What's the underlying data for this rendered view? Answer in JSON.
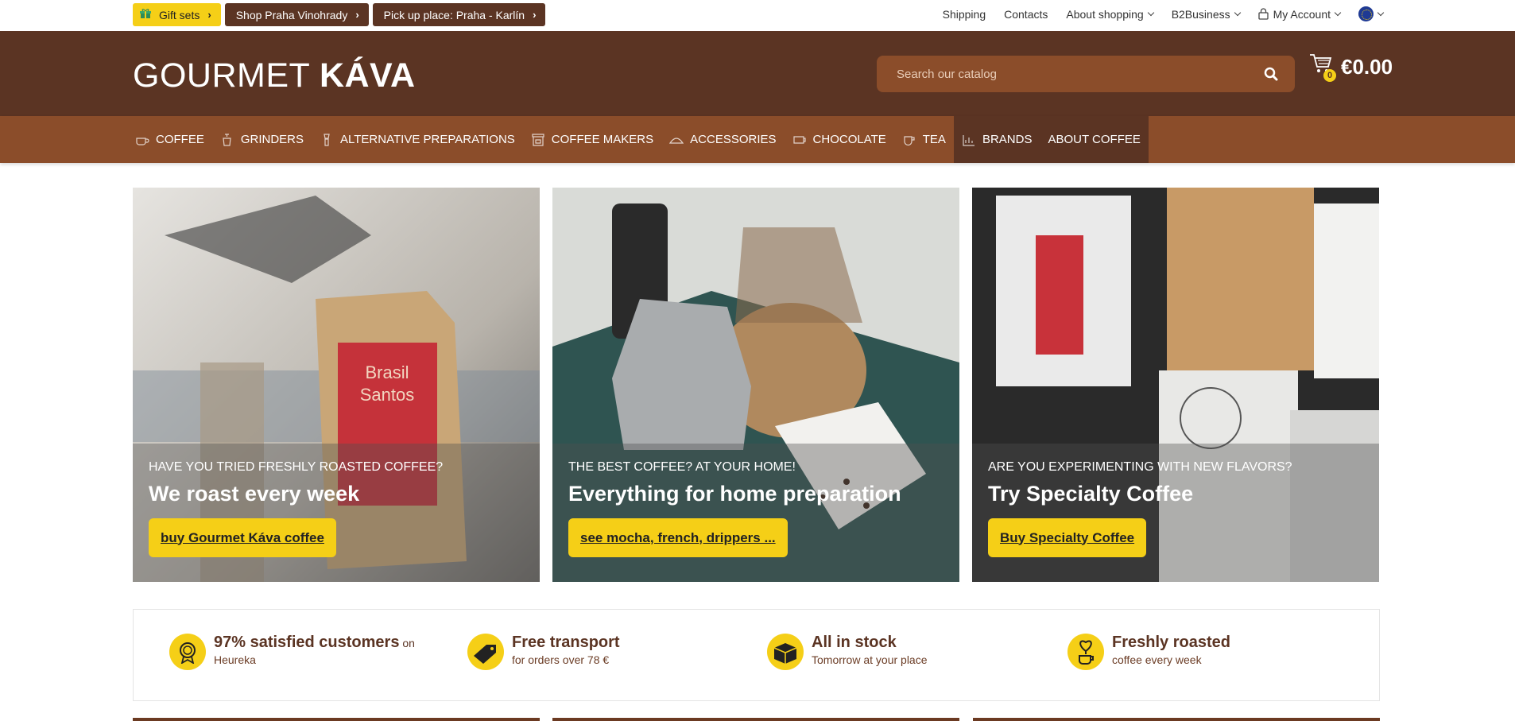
{
  "topbar": {
    "gift": "Gift sets",
    "shop": "Shop Praha Vinohrady",
    "pickup": "Pick up place: Praha - Karlín",
    "links": [
      "Shipping",
      "Contacts",
      "About shopping",
      "B2Business",
      "My Account"
    ]
  },
  "header": {
    "logo_light": "GOURMET ",
    "logo_bold": "KÁVA",
    "search_placeholder": "Search our catalog",
    "cart_count": "0",
    "cart_total": "€0.00"
  },
  "nav": [
    {
      "label": "COFFEE",
      "icon": "coffee-cup-icon"
    },
    {
      "label": "GRINDERS",
      "icon": "grinder-icon"
    },
    {
      "label": "ALTERNATIVE PREPARATIONS",
      "icon": "dripper-icon"
    },
    {
      "label": "COFFEE MAKERS",
      "icon": "coffee-maker-icon"
    },
    {
      "label": "ACCESSORIES",
      "icon": "accessories-icon"
    },
    {
      "label": "CHOCOLATE",
      "icon": "chocolate-icon"
    },
    {
      "label": "TEA",
      "icon": "tea-icon"
    },
    {
      "label": "BRANDS",
      "icon": "brands-icon"
    },
    {
      "label": "ABOUT COFFEE",
      "icon": ""
    }
  ],
  "banners": [
    {
      "sub": "HAVE YOU TRIED FRESHLY ROASTED COFFEE?",
      "title": "We roast every week",
      "cta": "buy Gourmet Káva coffee"
    },
    {
      "sub": "THE BEST COFFEE? AT YOUR HOME!",
      "title": "Everything for home preparation",
      "cta": "see mocha, french, drippers ..."
    },
    {
      "sub": "ARE YOU EXPERIMENTING WITH NEW FLAVORS?",
      "title": "Try Specialty Coffee",
      "cta": "Buy Specialty Coffee"
    }
  ],
  "features": [
    {
      "title": "97% satisfied customers",
      "title_suffix": " on",
      "sub": "Heureka",
      "icon": "award-icon"
    },
    {
      "title": "Free transport",
      "sub": "for orders over 78 €",
      "icon": "tag-icon"
    },
    {
      "title": "All in stock",
      "sub": "Tomorrow at your place",
      "icon": "box-icon"
    },
    {
      "title": "Freshly roasted",
      "sub": "coffee every week",
      "icon": "heart-cup-icon"
    }
  ],
  "colors": {
    "brown_dark": "#5b3423",
    "brown_nav": "#8b4d2a",
    "yellow": "#f5cf17"
  }
}
